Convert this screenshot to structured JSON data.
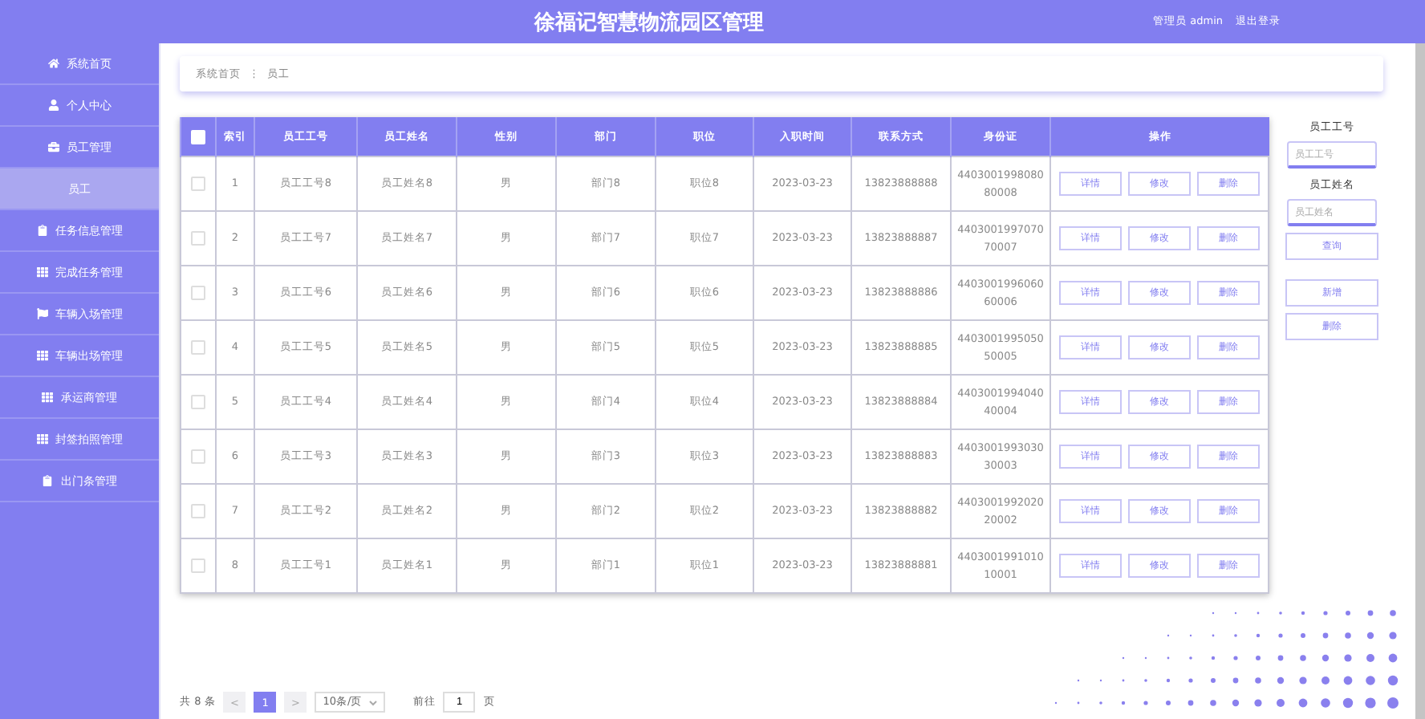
{
  "header": {
    "title": "徐福记智慧物流园区管理",
    "user": "管理员 admin",
    "logout": "退出登录"
  },
  "sidebar": {
    "items": [
      {
        "label": "系统首页",
        "kind": "home",
        "selected": false
      },
      {
        "label": "个人中心",
        "kind": "user",
        "selected": false
      },
      {
        "label": "员工管理",
        "kind": "briefcase",
        "selected": false
      },
      {
        "label": "员工",
        "kind": "submenu",
        "selected": true
      },
      {
        "label": "任务信息管理",
        "kind": "clipboard",
        "selected": false
      },
      {
        "label": "完成任务管理",
        "kind": "grid",
        "selected": false
      },
      {
        "label": "车辆入场管理",
        "kind": "flag",
        "selected": false
      },
      {
        "label": "车辆出场管理",
        "kind": "grid",
        "selected": false
      },
      {
        "label": "承运商管理",
        "kind": "grid",
        "selected": false
      },
      {
        "label": "封签拍照管理",
        "kind": "grid",
        "selected": false
      },
      {
        "label": "出门条管理",
        "kind": "clipboard",
        "selected": false
      }
    ]
  },
  "breadcrumb": {
    "items": [
      "系统首页",
      "员工"
    ],
    "separator": "⋮"
  },
  "table": {
    "columns": [
      "索引",
      "员工工号",
      "员工姓名",
      "性别",
      "部门",
      "职位",
      "入职时间",
      "联系方式",
      "身份证",
      "操作"
    ],
    "all_checked": false,
    "rows": [
      {
        "checked": false,
        "cells": [
          "1",
          "员工工号8",
          "员工姓名8",
          "男",
          "部门8",
          "职位8",
          "2023-03-23",
          "13823888888",
          "440300199808080008"
        ],
        "actions": [
          "详情",
          "修改",
          "删除"
        ]
      },
      {
        "checked": false,
        "cells": [
          "2",
          "员工工号7",
          "员工姓名7",
          "男",
          "部门7",
          "职位7",
          "2023-03-23",
          "13823888887",
          "440300199707070007"
        ],
        "actions": [
          "详情",
          "修改",
          "删除"
        ]
      },
      {
        "checked": false,
        "cells": [
          "3",
          "员工工号6",
          "员工姓名6",
          "男",
          "部门6",
          "职位6",
          "2023-03-23",
          "13823888886",
          "440300199606060006"
        ],
        "actions": [
          "详情",
          "修改",
          "删除"
        ]
      },
      {
        "checked": false,
        "cells": [
          "4",
          "员工工号5",
          "员工姓名5",
          "男",
          "部门5",
          "职位5",
          "2023-03-23",
          "13823888885",
          "440300199505050005"
        ],
        "actions": [
          "详情",
          "修改",
          "删除"
        ]
      },
      {
        "checked": false,
        "cells": [
          "5",
          "员工工号4",
          "员工姓名4",
          "男",
          "部门4",
          "职位4",
          "2023-03-23",
          "13823888884",
          "440300199404040004"
        ],
        "actions": [
          "详情",
          "修改",
          "删除"
        ]
      },
      {
        "checked": false,
        "cells": [
          "6",
          "员工工号3",
          "员工姓名3",
          "男",
          "部门3",
          "职位3",
          "2023-03-23",
          "13823888883",
          "440300199303030003"
        ],
        "actions": [
          "详情",
          "修改",
          "删除"
        ]
      },
      {
        "checked": false,
        "cells": [
          "7",
          "员工工号2",
          "员工姓名2",
          "男",
          "部门2",
          "职位2",
          "2023-03-23",
          "13823888882",
          "440300199202020002"
        ],
        "actions": [
          "详情",
          "修改",
          "删除"
        ]
      },
      {
        "checked": false,
        "cells": [
          "8",
          "员工工号1",
          "员工姓名1",
          "男",
          "部门1",
          "职位1",
          "2023-03-23",
          "13823888881",
          "440300199101010001"
        ],
        "actions": [
          "详情",
          "修改",
          "删除"
        ]
      }
    ]
  },
  "search": {
    "fields": [
      {
        "label": "员工工号",
        "placeholder": "员工工号"
      },
      {
        "label": "员工姓名",
        "placeholder": "员工姓名"
      }
    ],
    "query": "查询",
    "add": "新增",
    "delete": "删除"
  },
  "pagination": {
    "total": "共 8 条",
    "prev": "<",
    "pages": [
      {
        "label": "1",
        "selected": true
      }
    ],
    "next": ">",
    "page_size": "10条/页",
    "goto": "前往",
    "goto_value": "1",
    "page_unit": "页"
  }
}
